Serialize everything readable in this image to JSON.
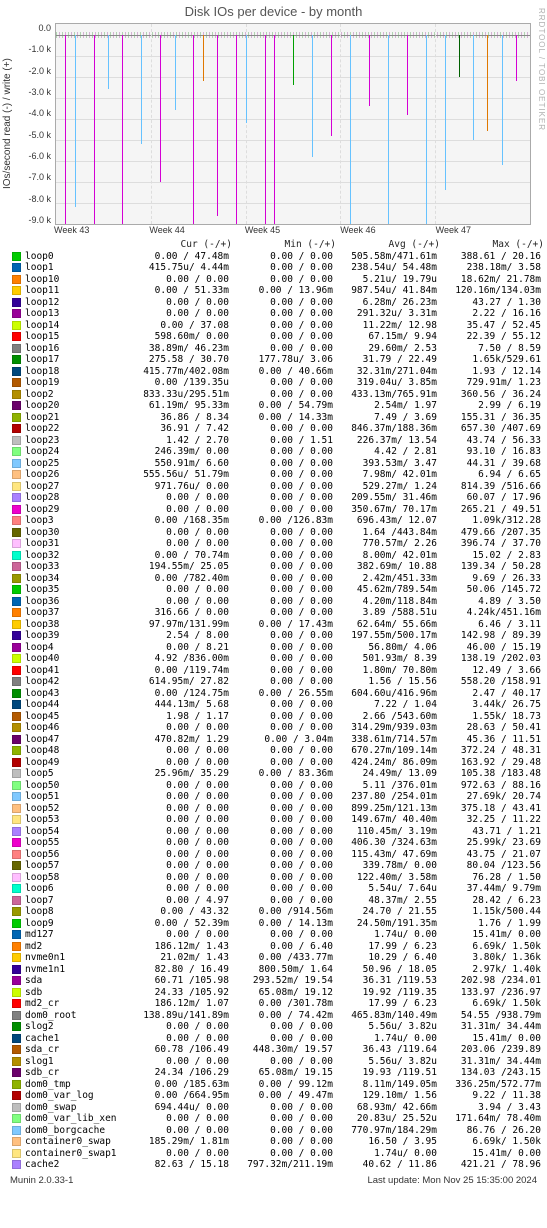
{
  "title": "Disk IOs per device - by month",
  "ylabel": "IOs/second read (-) / write (+)",
  "watermark": "RRDTOOL / TOBI OETIKER",
  "footer_left": "Munin 2.0.33-1",
  "footer_right": "Last update: Mon Nov 25 15:35:00 2024",
  "chart_data": {
    "type": "line",
    "title": "Disk IOs per device - by month",
    "ylabel": "IOs/second read (-) / write (+)",
    "ylim": [
      -9000,
      500
    ],
    "y_ticks": [
      "0.0",
      "-1.0 k",
      "-2.0 k",
      "-3.0 k",
      "-4.0 k",
      "-5.0 k",
      "-6.0 k",
      "-7.0 k",
      "-8.0 k",
      "-9.0 k"
    ],
    "x_categories": [
      "Week 43",
      "Week 44",
      "Week 45",
      "Week 46",
      "Week 47"
    ],
    "note": "Visual shows many short negative (read) spikes of various devices reaching roughly -2k to -9k, positive (write) values stay near zero.",
    "spikes_estimate": [
      {
        "x_pct": 2,
        "depth": -9000,
        "color": "#d400d4"
      },
      {
        "x_pct": 4,
        "depth": -8200,
        "color": "#66c2ff"
      },
      {
        "x_pct": 8,
        "depth": -9000,
        "color": "#d400d4"
      },
      {
        "x_pct": 11,
        "depth": -2600,
        "color": "#66c2ff"
      },
      {
        "x_pct": 14,
        "depth": -9000,
        "color": "#d400d4"
      },
      {
        "x_pct": 18,
        "depth": -5200,
        "color": "#66c2ff"
      },
      {
        "x_pct": 22,
        "depth": -7000,
        "color": "#d400d4"
      },
      {
        "x_pct": 25,
        "depth": -3600,
        "color": "#66c2ff"
      },
      {
        "x_pct": 29,
        "depth": -9000,
        "color": "#d400d4"
      },
      {
        "x_pct": 31,
        "depth": -2200,
        "color": "#e07800"
      },
      {
        "x_pct": 34,
        "depth": -8600,
        "color": "#d400d4"
      },
      {
        "x_pct": 38,
        "depth": -9000,
        "color": "#d400d4"
      },
      {
        "x_pct": 40,
        "depth": -4200,
        "color": "#66c2ff"
      },
      {
        "x_pct": 44,
        "depth": -9000,
        "color": "#d400d4"
      },
      {
        "x_pct": 46,
        "depth": -9000,
        "color": "#d400d4"
      },
      {
        "x_pct": 50,
        "depth": -2400,
        "color": "#00a000"
      },
      {
        "x_pct": 54,
        "depth": -5800,
        "color": "#66c2ff"
      },
      {
        "x_pct": 58,
        "depth": -4800,
        "color": "#d400d4"
      },
      {
        "x_pct": 62,
        "depth": -9000,
        "color": "#66c2ff"
      },
      {
        "x_pct": 66,
        "depth": -3400,
        "color": "#d400d4"
      },
      {
        "x_pct": 70,
        "depth": -9000,
        "color": "#66c2ff"
      },
      {
        "x_pct": 74,
        "depth": -3800,
        "color": "#d400d4"
      },
      {
        "x_pct": 78,
        "depth": -9000,
        "color": "#66c2ff"
      },
      {
        "x_pct": 82,
        "depth": -7400,
        "color": "#66c2ff"
      },
      {
        "x_pct": 85,
        "depth": -2000,
        "color": "#006000"
      },
      {
        "x_pct": 88,
        "depth": -5000,
        "color": "#66c2ff"
      },
      {
        "x_pct": 91,
        "depth": -4600,
        "color": "#e07800"
      },
      {
        "x_pct": 94,
        "depth": -6200,
        "color": "#66c2ff"
      },
      {
        "x_pct": 97,
        "depth": -2200,
        "color": "#d400d4"
      }
    ]
  },
  "legend_headers": [
    "Cur (-/+)",
    "Min (-/+)",
    "Avg (-/+)",
    "Max (-/+)"
  ],
  "series": [
    {
      "name": "loop0",
      "color": "#00cc00",
      "cur": "0.00 / 47.48m",
      "min": "0.00 /  0.00",
      "avg": "505.58m/471.61m",
      "max": "388.61 / 20.16"
    },
    {
      "name": "loop1",
      "color": "#0066b3",
      "cur": "415.75u/  4.44m",
      "min": "0.00 /  0.00",
      "avg": "238.54u/ 54.48m",
      "max": "238.18m/  3.58"
    },
    {
      "name": "loop10",
      "color": "#ff8000",
      "cur": "0.00 /  0.00",
      "min": "0.00 /  0.00",
      "avg": "5.21u/ 19.79u",
      "max": "18.62m/ 21.78m"
    },
    {
      "name": "loop11",
      "color": "#ffcc00",
      "cur": "0.00 / 51.33m",
      "min": "0.00 / 13.96m",
      "avg": "987.54u/ 41.84m",
      "max": "120.16m/134.03m"
    },
    {
      "name": "loop12",
      "color": "#330099",
      "cur": "0.00 /  0.00",
      "min": "0.00 /  0.00",
      "avg": "6.28m/ 26.23m",
      "max": "43.27 /  1.30"
    },
    {
      "name": "loop13",
      "color": "#990099",
      "cur": "0.00 /  0.00",
      "min": "0.00 /  0.00",
      "avg": "291.32u/  3.31m",
      "max": "2.22 / 16.16"
    },
    {
      "name": "loop14",
      "color": "#ccff00",
      "cur": "0.00 / 37.08",
      "min": "0.00 /  0.00",
      "avg": "11.22m/ 12.98",
      "max": "35.47 / 52.45"
    },
    {
      "name": "loop15",
      "color": "#ff0000",
      "cur": "598.60m/  0.00",
      "min": "0.00 /  0.00",
      "avg": "67.15m/  9.94",
      "max": "22.39 / 55.12"
    },
    {
      "name": "loop16",
      "color": "#808080",
      "cur": "38.89m/ 46.23m",
      "min": "0.00 /  0.00",
      "avg": "29.60m/  2.53",
      "max": "7.50 /  8.59"
    },
    {
      "name": "loop17",
      "color": "#008f00",
      "cur": "275.58 / 30.70",
      "min": "177.78u/  3.06",
      "avg": "31.79 / 22.49",
      "max": "1.65k/529.61"
    },
    {
      "name": "loop18",
      "color": "#00487d",
      "cur": "415.77m/402.08m",
      "min": "0.00 / 40.66m",
      "avg": "32.31m/271.04m",
      "max": "1.93 / 12.14"
    },
    {
      "name": "loop19",
      "color": "#b35a00",
      "cur": "0.00 /139.35u",
      "min": "0.00 /  0.00",
      "avg": "319.04u/  3.85m",
      "max": "729.91m/  1.23"
    },
    {
      "name": "loop2",
      "color": "#b38f00",
      "cur": "833.33u/295.51m",
      "min": "0.00 /  0.00",
      "avg": "433.13m/765.91m",
      "max": "360.56 / 36.24"
    },
    {
      "name": "loop20",
      "color": "#6b006b",
      "cur": "61.19m/ 95.33m",
      "min": "0.00 / 54.79m",
      "avg": "2.54m/  1.97",
      "max": "2.99 /  6.19"
    },
    {
      "name": "loop21",
      "color": "#8fb300",
      "cur": "36.86 /  8.34",
      "min": "0.00 / 14.33m",
      "avg": "7.49 /  3.69",
      "max": "155.31 / 36.35"
    },
    {
      "name": "loop22",
      "color": "#b30000",
      "cur": "36.91 /  7.42",
      "min": "0.00 /  0.00",
      "avg": "846.37m/188.36m",
      "max": "657.30 /407.69"
    },
    {
      "name": "loop23",
      "color": "#bebebe",
      "cur": "1.42 /  2.70",
      "min": "0.00 /  1.51",
      "avg": "226.37m/ 13.54",
      "max": "43.74 / 56.33"
    },
    {
      "name": "loop24",
      "color": "#80ff80",
      "cur": "246.39m/  0.00",
      "min": "0.00 /  0.00",
      "avg": "4.42 /  2.81",
      "max": "93.10 / 16.83"
    },
    {
      "name": "loop25",
      "color": "#80c9ff",
      "cur": "550.91m/  6.60",
      "min": "0.00 /  0.00",
      "avg": "393.53m/  3.47",
      "max": "44.31 / 39.68"
    },
    {
      "name": "loop26",
      "color": "#ffc080",
      "cur": "555.56u/ 51.79m",
      "min": "0.00 /  0.00",
      "avg": "7.98m/ 42.01m",
      "max": "6.94 /  6.65"
    },
    {
      "name": "loop27",
      "color": "#ffe680",
      "cur": "971.76u/  0.00",
      "min": "0.00 /  0.00",
      "avg": "529.27m/  1.24",
      "max": "814.39 /516.66"
    },
    {
      "name": "loop28",
      "color": "#aa80ff",
      "cur": "0.00 /  0.00",
      "min": "0.00 /  0.00",
      "avg": "209.55m/ 31.46m",
      "max": "60.07 / 17.96"
    },
    {
      "name": "loop29",
      "color": "#ee00cc",
      "cur": "0.00 /  0.00",
      "min": "0.00 /  0.00",
      "avg": "350.67m/ 70.17m",
      "max": "265.21 / 49.51"
    },
    {
      "name": "loop3",
      "color": "#ff8080",
      "cur": "0.00 /168.35m",
      "min": "0.00 /126.83m",
      "avg": "696.43m/ 12.07",
      "max": "1.09k/312.28"
    },
    {
      "name": "loop30",
      "color": "#666600",
      "cur": "0.00 /  0.00",
      "min": "0.00 /  0.00",
      "avg": "1.64 /443.84m",
      "max": "479.66 /207.35"
    },
    {
      "name": "loop31",
      "color": "#ffbfff",
      "cur": "0.00 /  0.00",
      "min": "0.00 /  0.00",
      "avg": "770.57m/  2.26",
      "max": "396.74 / 37.70"
    },
    {
      "name": "loop32",
      "color": "#00ffcc",
      "cur": "0.00 / 70.74m",
      "min": "0.00 /  0.00",
      "avg": "8.00m/ 42.01m",
      "max": "15.02 /  2.83"
    },
    {
      "name": "loop33",
      "color": "#cc6699",
      "cur": "194.55m/ 25.05",
      "min": "0.00 /  0.00",
      "avg": "382.69m/ 10.88",
      "max": "139.34 / 50.28"
    },
    {
      "name": "loop34",
      "color": "#999900",
      "cur": "0.00 /782.40m",
      "min": "0.00 /  0.00",
      "avg": "2.42m/451.33m",
      "max": "9.69 / 26.33"
    },
    {
      "name": "loop35",
      "color": "#00cc00",
      "cur": "0.00 /  0.00",
      "min": "0.00 /  0.00",
      "avg": "45.62m/789.54m",
      "max": "50.06 /145.72"
    },
    {
      "name": "loop36",
      "color": "#0066b3",
      "cur": "0.00 /  0.00",
      "min": "0.00 /  0.00",
      "avg": "4.20m/118.84m",
      "max": "4.89 /  3.50"
    },
    {
      "name": "loop37",
      "color": "#ff8000",
      "cur": "316.66 /  0.00",
      "min": "0.00 /  0.00",
      "avg": "3.89 /588.51u",
      "max": "4.24k/451.16m"
    },
    {
      "name": "loop38",
      "color": "#ffcc00",
      "cur": "97.97m/131.99m",
      "min": "0.00 / 17.43m",
      "avg": "62.64m/ 55.66m",
      "max": "6.46 /  3.11"
    },
    {
      "name": "loop39",
      "color": "#330099",
      "cur": "2.54 /  8.00",
      "min": "0.00 /  0.00",
      "avg": "197.55m/500.17m",
      "max": "142.98 / 89.39"
    },
    {
      "name": "loop4",
      "color": "#990099",
      "cur": "0.00 /  8.21",
      "min": "0.00 /  0.00",
      "avg": "56.80m/  4.06",
      "max": "46.00 / 15.19"
    },
    {
      "name": "loop40",
      "color": "#ccff00",
      "cur": "4.92 /836.00m",
      "min": "0.00 /  0.00",
      "avg": "501.93m/  8.39",
      "max": "138.19 /202.03"
    },
    {
      "name": "loop41",
      "color": "#ff0000",
      "cur": "0.00 /119.74m",
      "min": "0.00 /  0.00",
      "avg": "1.80m/ 70.80m",
      "max": "12.49 /  3.66"
    },
    {
      "name": "loop42",
      "color": "#808080",
      "cur": "614.95m/ 27.82",
      "min": "0.00 /  0.00",
      "avg": "1.56 / 15.56",
      "max": "558.20 /158.91"
    },
    {
      "name": "loop43",
      "color": "#008f00",
      "cur": "0.00 /124.75m",
      "min": "0.00 / 26.55m",
      "avg": "604.60u/416.96m",
      "max": "2.47 / 40.17"
    },
    {
      "name": "loop44",
      "color": "#00487d",
      "cur": "444.13m/  5.68",
      "min": "0.00 /  0.00",
      "avg": "7.22 /  1.04",
      "max": "3.44k/ 26.75"
    },
    {
      "name": "loop45",
      "color": "#b35a00",
      "cur": "1.98 /  1.17",
      "min": "0.00 /  0.00",
      "avg": "2.66 /543.60m",
      "max": "1.55k/ 18.73"
    },
    {
      "name": "loop46",
      "color": "#b38f00",
      "cur": "0.00 /  0.00",
      "min": "0.00 /  0.00",
      "avg": "314.29m/939.03m",
      "max": "28.63 / 50.41"
    },
    {
      "name": "loop47",
      "color": "#6b006b",
      "cur": "470.82m/  1.29",
      "min": "0.00 /  3.04m",
      "avg": "338.61m/714.57m",
      "max": "45.36 / 11.51"
    },
    {
      "name": "loop48",
      "color": "#8fb300",
      "cur": "0.00 /  0.00",
      "min": "0.00 /  0.00",
      "avg": "670.27m/109.14m",
      "max": "372.24 / 48.31"
    },
    {
      "name": "loop49",
      "color": "#b30000",
      "cur": "0.00 /  0.00",
      "min": "0.00 /  0.00",
      "avg": "424.24m/ 86.09m",
      "max": "163.92 / 29.48"
    },
    {
      "name": "loop5",
      "color": "#bebebe",
      "cur": "25.96m/ 35.29",
      "min": "0.00 / 83.36m",
      "avg": "24.49m/ 13.09",
      "max": "105.38 /183.48"
    },
    {
      "name": "loop50",
      "color": "#80ff80",
      "cur": "0.00 /  0.00",
      "min": "0.00 /  0.00",
      "avg": "5.11 /376.01m",
      "max": "972.63 / 88.16"
    },
    {
      "name": "loop51",
      "color": "#80c9ff",
      "cur": "0.00 /  0.00",
      "min": "0.00 /  0.00",
      "avg": "237.80 /254.01m",
      "max": "27.69k/ 20.74"
    },
    {
      "name": "loop52",
      "color": "#ffc080",
      "cur": "0.00 /  0.00",
      "min": "0.00 /  0.00",
      "avg": "899.25m/121.13m",
      "max": "375.18 / 43.41"
    },
    {
      "name": "loop53",
      "color": "#ffe680",
      "cur": "0.00 /  0.00",
      "min": "0.00 /  0.00",
      "avg": "149.67m/ 40.40m",
      "max": "32.25 / 11.22"
    },
    {
      "name": "loop54",
      "color": "#aa80ff",
      "cur": "0.00 /  0.00",
      "min": "0.00 /  0.00",
      "avg": "110.45m/  3.19m",
      "max": "43.71 /  1.21"
    },
    {
      "name": "loop55",
      "color": "#ee00cc",
      "cur": "0.00 /  0.00",
      "min": "0.00 /  0.00",
      "avg": "406.30 /324.63m",
      "max": "25.99k/ 23.69"
    },
    {
      "name": "loop56",
      "color": "#ff8080",
      "cur": "0.00 /  0.00",
      "min": "0.00 /  0.00",
      "avg": "115.43m/ 47.69m",
      "max": "43.75 / 21.07"
    },
    {
      "name": "loop57",
      "color": "#666600",
      "cur": "0.00 /  0.00",
      "min": "0.00 /  0.00",
      "avg": "339.78m/  0.00",
      "max": "80.04 /123.56"
    },
    {
      "name": "loop58",
      "color": "#ffbfff",
      "cur": "0.00 /  0.00",
      "min": "0.00 /  0.00",
      "avg": "122.40m/  3.58m",
      "max": "76.28 /  1.50"
    },
    {
      "name": "loop6",
      "color": "#00ffcc",
      "cur": "0.00 /  0.00",
      "min": "0.00 /  0.00",
      "avg": "5.54u/  7.64u",
      "max": "37.44m/  9.79m"
    },
    {
      "name": "loop7",
      "color": "#cc6699",
      "cur": "0.00 /  4.97",
      "min": "0.00 /  0.00",
      "avg": "48.37m/  2.55",
      "max": "28.42 /  6.23"
    },
    {
      "name": "loop8",
      "color": "#999900",
      "cur": "0.00 / 43.32",
      "min": "0.00 /914.56m",
      "avg": "24.70 / 21.55",
      "max": "1.15k/500.44"
    },
    {
      "name": "loop9",
      "color": "#00cc00",
      "cur": "0.00 / 52.39m",
      "min": "0.00 / 14.13m",
      "avg": "24.50m/191.35m",
      "max": "1.76 /  1.99"
    },
    {
      "name": "md127",
      "color": "#0066b3",
      "cur": "0.00 /  0.00",
      "min": "0.00 /  0.00",
      "avg": "1.74u/  0.00",
      "max": "15.41m/  0.00"
    },
    {
      "name": "md2",
      "color": "#ff8000",
      "cur": "186.12m/  1.43",
      "min": "0.00 /  6.40",
      "avg": "17.99 /  6.23",
      "max": "6.69k/  1.50k"
    },
    {
      "name": "nvme0n1",
      "color": "#ffcc00",
      "cur": "21.02m/  1.43",
      "min": "0.00 /433.77m",
      "avg": "10.29 /  6.40",
      "max": "3.80k/  1.36k"
    },
    {
      "name": "nvme1n1",
      "color": "#330099",
      "cur": "82.80 / 16.49",
      "min": "800.50m/  1.64",
      "avg": "50.96 / 18.05",
      "max": "2.97k/  1.40k"
    },
    {
      "name": "sda",
      "color": "#990099",
      "cur": "60.71 /105.98",
      "min": "293.52m/ 19.54",
      "avg": "36.31 /119.53",
      "max": "202.98 /234.01"
    },
    {
      "name": "sdb",
      "color": "#ccff00",
      "cur": "24.33 /105.92",
      "min": "65.08m/ 19.12",
      "avg": "19.92 /119.35",
      "max": "133.97 /236.97"
    },
    {
      "name": "md2_cr",
      "color": "#ff0000",
      "cur": "186.12m/  1.07",
      "min": "0.00 /301.78m",
      "avg": "17.99 /  6.23",
      "max": "6.69k/  1.50k"
    },
    {
      "name": "dom0_root",
      "color": "#808080",
      "cur": "138.89u/141.89m",
      "min": "0.00 / 74.42m",
      "avg": "465.83m/140.49m",
      "max": "54.55 /938.79m"
    },
    {
      "name": "slog2",
      "color": "#008f00",
      "cur": "0.00 /  0.00",
      "min": "0.00 /  0.00",
      "avg": "5.56u/  3.82u",
      "max": "31.31m/ 34.44m"
    },
    {
      "name": "cache1",
      "color": "#00487d",
      "cur": "0.00 /  0.00",
      "min": "0.00 /  0.00",
      "avg": "1.74u/  0.00",
      "max": "15.41m/  0.00"
    },
    {
      "name": "sda_cr",
      "color": "#b35a00",
      "cur": "60.78 /106.49",
      "min": "448.30m/ 19.57",
      "avg": "36.43 /119.64",
      "max": "203.06 /239.89"
    },
    {
      "name": "slog1",
      "color": "#b38f00",
      "cur": "0.00 /  0.00",
      "min": "0.00 /  0.00",
      "avg": "5.56u/  3.82u",
      "max": "31.31m/ 34.44m"
    },
    {
      "name": "sdb_cr",
      "color": "#6b006b",
      "cur": "24.34 /106.29",
      "min": "65.08m/ 19.15",
      "avg": "19.93 /119.51",
      "max": "134.03 /243.15"
    },
    {
      "name": "dom0_tmp",
      "color": "#8fb300",
      "cur": "0.00 /185.63m",
      "min": "0.00 / 99.12m",
      "avg": "8.11m/149.05m",
      "max": "336.25m/572.77m"
    },
    {
      "name": "dom0_var_log",
      "color": "#b30000",
      "cur": "0.00 /664.95m",
      "min": "0.00 / 49.47m",
      "avg": "129.10m/  1.56",
      "max": "9.22 / 11.38"
    },
    {
      "name": "dom0_swap",
      "color": "#bebebe",
      "cur": "694.44u/  0.00",
      "min": "0.00 /  0.00",
      "avg": "68.93m/ 42.66m",
      "max": "3.94 /  3.43"
    },
    {
      "name": "dom0_var_lib_xen",
      "color": "#80ff80",
      "cur": "0.00 /  0.00",
      "min": "0.00 /  0.00",
      "avg": "20.83u/ 25.52u",
      "max": "171.64m/ 78.40m"
    },
    {
      "name": "dom0_borgcache",
      "color": "#80c9ff",
      "cur": "0.00 /  0.00",
      "min": "0.00 /  0.00",
      "avg": "770.97m/184.29m",
      "max": "86.76 / 26.20"
    },
    {
      "name": "container0_swap",
      "color": "#ffc080",
      "cur": "185.29m/  1.81m",
      "min": "0.00 /  0.00",
      "avg": "16.50 /  3.95",
      "max": "6.69k/  1.50k"
    },
    {
      "name": "container0_swap1",
      "color": "#ffe680",
      "cur": "0.00 /  0.00",
      "min": "0.00 /  0.00",
      "avg": "1.74u/  0.00",
      "max": "15.41m/  0.00"
    },
    {
      "name": "cache2",
      "color": "#aa80ff",
      "cur": "82.63 / 15.18",
      "min": "797.32m/211.19m",
      "avg": "40.62 / 11.86",
      "max": "421.21 / 78.96"
    }
  ]
}
